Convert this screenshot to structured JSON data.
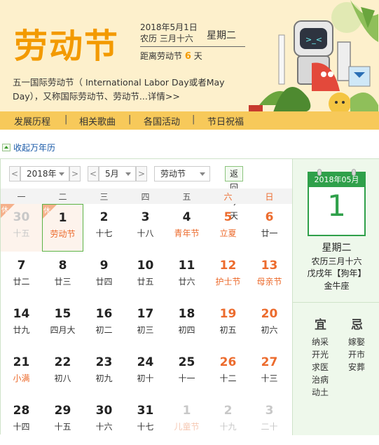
{
  "banner": {
    "title": "劳动节",
    "date": "2018年5月1日",
    "lunar": "农历 三月十六",
    "weekday": "星期二",
    "countdown_prefix": "距离劳动节",
    "countdown_num": "6",
    "countdown_suffix": "天",
    "intro": "五一国际劳动节（ International Labor Day或者May Day），又称国际劳动节、劳动节...",
    "intro_more": "详情>>",
    "nav": [
      "发展历程",
      "相关歌曲",
      "各国活动",
      "节日祝福"
    ],
    "nav_sep": "|"
  },
  "collapse_label": "收起万年历",
  "toolbar": {
    "prev": "<",
    "next": ">",
    "year": "2018年",
    "month": "5月",
    "festival": "劳动节",
    "today": "返回今天"
  },
  "weekdays": [
    "一",
    "二",
    "三",
    "四",
    "五",
    "六",
    "日"
  ],
  "holiday_badge": "休",
  "weeks": [
    [
      {
        "d": "30",
        "l": "十五",
        "other": true,
        "holiday": true,
        "badge": true
      },
      {
        "d": "1",
        "l": "劳动节",
        "fest": true,
        "holiday": true,
        "badge": true,
        "selected": true
      },
      {
        "d": "2",
        "l": "十七"
      },
      {
        "d": "3",
        "l": "十八"
      },
      {
        "d": "4",
        "l": "青年节",
        "fest": true
      },
      {
        "d": "5",
        "l": "立夏",
        "fest": true,
        "weekend": true
      },
      {
        "d": "6",
        "l": "廿一",
        "weekend": true
      }
    ],
    [
      {
        "d": "7",
        "l": "廿二"
      },
      {
        "d": "8",
        "l": "廿三"
      },
      {
        "d": "9",
        "l": "廿四"
      },
      {
        "d": "10",
        "l": "廿五"
      },
      {
        "d": "11",
        "l": "廿六"
      },
      {
        "d": "12",
        "l": "护士节",
        "fest": true,
        "weekend": true
      },
      {
        "d": "13",
        "l": "母亲节",
        "fest": true,
        "weekend": true
      }
    ],
    [
      {
        "d": "14",
        "l": "廿九"
      },
      {
        "d": "15",
        "l": "四月大"
      },
      {
        "d": "16",
        "l": "初二"
      },
      {
        "d": "17",
        "l": "初三"
      },
      {
        "d": "18",
        "l": "初四"
      },
      {
        "d": "19",
        "l": "初五",
        "weekend": true
      },
      {
        "d": "20",
        "l": "初六",
        "weekend": true
      }
    ],
    [
      {
        "d": "21",
        "l": "小满",
        "fest": true
      },
      {
        "d": "22",
        "l": "初八"
      },
      {
        "d": "23",
        "l": "初九"
      },
      {
        "d": "24",
        "l": "初十"
      },
      {
        "d": "25",
        "l": "十一"
      },
      {
        "d": "26",
        "l": "十二",
        "weekend": true
      },
      {
        "d": "27",
        "l": "十三",
        "weekend": true
      }
    ],
    [
      {
        "d": "28",
        "l": "十四"
      },
      {
        "d": "29",
        "l": "十五"
      },
      {
        "d": "30",
        "l": "十六"
      },
      {
        "d": "31",
        "l": "十七"
      },
      {
        "d": "1",
        "l": "儿童节",
        "fest": true,
        "other": true
      },
      {
        "d": "2",
        "l": "十九",
        "other": true,
        "weekend": true
      },
      {
        "d": "3",
        "l": "二十",
        "other": true,
        "weekend": true
      }
    ]
  ],
  "side": {
    "card_head": "2018年05月",
    "card_day": "1",
    "weekday": "星期二",
    "lunar": "农历三月十六",
    "ganzhi": "戊戌年【狗年】",
    "zodiac": "金牛座",
    "yi_title": "宜",
    "ji_title": "忌",
    "yi": [
      "纳采",
      "开光",
      "求医",
      "治病",
      "动土"
    ],
    "ji": [
      "嫁娶",
      "开市",
      "安葬"
    ]
  },
  "colors": {
    "accent_orange": "#f39a00",
    "weekend": "#ec6b2d",
    "green": "#2fa04a",
    "nav_bar": "#f7c95a"
  }
}
